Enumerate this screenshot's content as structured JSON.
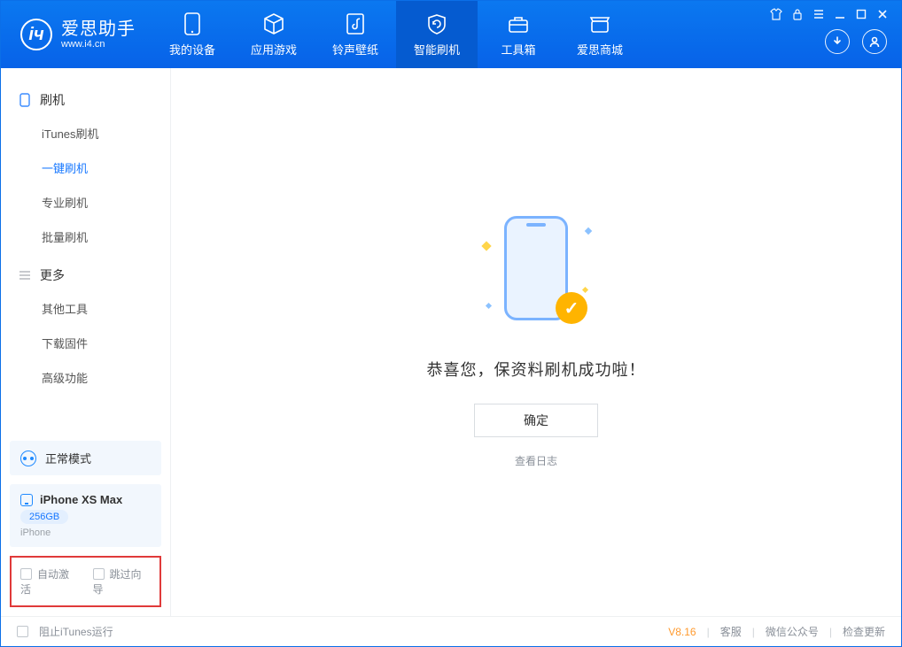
{
  "app": {
    "name_cn": "爱思助手",
    "url": "www.i4.cn"
  },
  "nav": {
    "items": [
      {
        "label": "我的设备"
      },
      {
        "label": "应用游戏"
      },
      {
        "label": "铃声壁纸"
      },
      {
        "label": "智能刷机"
      },
      {
        "label": "工具箱"
      },
      {
        "label": "爱思商城"
      }
    ]
  },
  "sidebar": {
    "section_flash": "刷机",
    "items_flash": [
      {
        "label": "iTunes刷机"
      },
      {
        "label": "一键刷机"
      },
      {
        "label": "专业刷机"
      },
      {
        "label": "批量刷机"
      }
    ],
    "section_more": "更多",
    "items_more": [
      {
        "label": "其他工具"
      },
      {
        "label": "下载固件"
      },
      {
        "label": "高级功能"
      }
    ]
  },
  "device": {
    "mode": "正常模式",
    "name": "iPhone XS Max",
    "storage": "256GB",
    "type": "iPhone"
  },
  "options": {
    "auto_activate": "自动激活",
    "skip_guide": "跳过向导"
  },
  "main": {
    "success_text": "恭喜您，保资料刷机成功啦！",
    "ok_button": "确定",
    "view_log": "查看日志"
  },
  "footer": {
    "block_itunes": "阻止iTunes运行",
    "version": "V8.16",
    "support": "客服",
    "wechat": "微信公众号",
    "check_update": "检查更新"
  }
}
